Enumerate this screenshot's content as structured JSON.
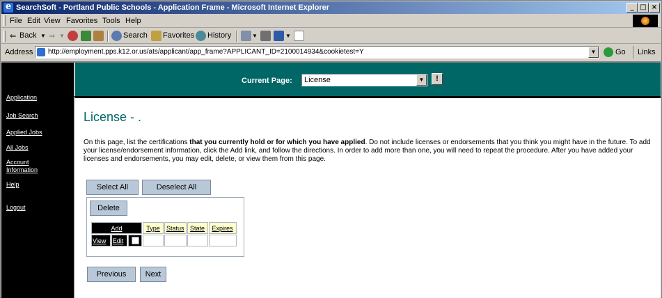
{
  "window": {
    "title": "SearchSoft - Portland Public Schools - Application Frame - Microsoft Internet Explorer",
    "controls": [
      "_",
      "□",
      "×"
    ]
  },
  "menu": {
    "items": [
      "File",
      "Edit",
      "View",
      "Favorites",
      "Tools",
      "Help"
    ]
  },
  "toolbar": {
    "back": "Back",
    "search": "Search",
    "favorites": "Favorites",
    "history": "History"
  },
  "address": {
    "label": "Address",
    "url": "http://employment.pps.k12.or.us/ats/applicant/app_frame?APPLICANT_ID=2100014934&cookietest=Y",
    "go": "Go",
    "links": "Links"
  },
  "sidebar": {
    "items": [
      "Application",
      "Job Search",
      "Applied Jobs",
      "All Jobs",
      "Account Information",
      "Help",
      "Logout"
    ]
  },
  "header": {
    "current_page_label": "Current Page:",
    "current_page_value": "License",
    "warn_label": "!"
  },
  "main": {
    "title": "License - .",
    "intro_before": "On this page, list the certifications ",
    "intro_bold": "that you currently hold or for which you have applied",
    "intro_after": ". Do not include licenses or endorsements that you think you might have in the future. To add your license/endorsement information, click the Add link, and follow the directions. In order to add more than one, you will need to repeat the procedure. After you have added your licenses and endorsements, you may edit, delete, or view them from this page.",
    "select_all": "Select All",
    "deselect_all": "Deselect All",
    "delete": "Delete",
    "table": {
      "add": "Add",
      "columns": [
        "Type",
        "Status",
        "State",
        "Expires"
      ],
      "row_actions": [
        "View",
        "Edit"
      ]
    },
    "previous": "Previous",
    "next": "Next"
  },
  "colors": {
    "teal": "#006666",
    "titlebar": "#0a246a",
    "button": "#b8c8d8"
  }
}
